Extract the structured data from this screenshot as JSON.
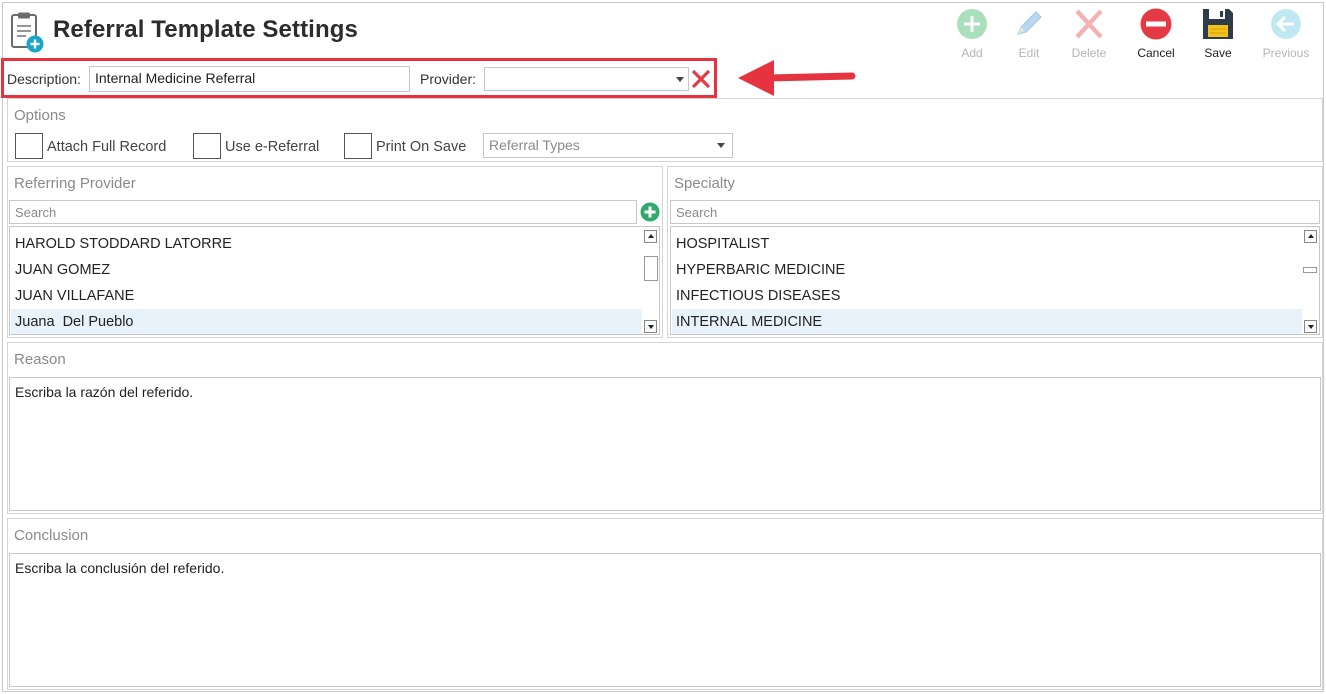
{
  "header": {
    "title": "Referral Template Settings",
    "icon": "clipboard-add-icon"
  },
  "toolbar": {
    "add_label": "Add",
    "edit_label": "Edit",
    "delete_label": "Delete",
    "cancel_label": "Cancel",
    "save_label": "Save",
    "previous_label": "Previous"
  },
  "form": {
    "description_label": "Description:",
    "description_value": "Internal Medicine Referral",
    "provider_label": "Provider:",
    "provider_value": ""
  },
  "options": {
    "title": "Options",
    "attach_full_record_label": "Attach Full Record",
    "use_e_referral_label": "Use e-Referral",
    "print_on_save_label": "Print On Save",
    "referral_types_placeholder": "Referral Types"
  },
  "referring_provider": {
    "title": "Referring Provider",
    "search_placeholder": "Search",
    "items": [
      {
        "label": "HAROLD STODDARD LATORRE",
        "selected": false
      },
      {
        "label": "JUAN GOMEZ",
        "selected": false
      },
      {
        "label": "JUAN VILLAFANE",
        "selected": false
      },
      {
        "label": "Juana  Del Pueblo",
        "selected": true
      }
    ]
  },
  "specialty": {
    "title": "Specialty",
    "search_placeholder": "Search",
    "items": [
      {
        "label": "HOSPITALIST",
        "selected": false
      },
      {
        "label": "HYPERBARIC MEDICINE",
        "selected": false
      },
      {
        "label": "INFECTIOUS DISEASES",
        "selected": false
      },
      {
        "label": "INTERNAL MEDICINE",
        "selected": true
      }
    ]
  },
  "reason": {
    "title": "Reason",
    "text": "Escriba la razón del referido."
  },
  "conclusion": {
    "title": "Conclusion",
    "text": "Escriba la conclusión del referido."
  },
  "colors": {
    "highlight_border": "#e5343f",
    "add_green": "#2eaa6a",
    "cancel_red": "#e33a45",
    "selected_row": "#e8f2fb"
  }
}
